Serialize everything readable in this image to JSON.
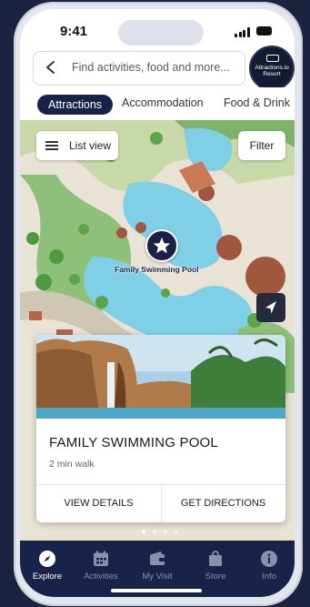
{
  "status_bar": {
    "time": "9:41"
  },
  "search": {
    "placeholder": "Find activities, food and more..."
  },
  "brand": {
    "logo_text": "Attractions.io Resort"
  },
  "tabs": [
    {
      "label": "Attractions",
      "active": true
    },
    {
      "label": "Accommodation",
      "active": false
    },
    {
      "label": "Food & Drink",
      "active": false
    }
  ],
  "map": {
    "list_view_label": "List view",
    "filter_label": "Filter",
    "pin_label": "Family Swimming Pool",
    "pin_icon": "star-icon",
    "location_icon": "navigation-arrow-icon"
  },
  "card": {
    "title": "FAMILY SWIMMING POOL",
    "subtitle": "2 min walk",
    "view_details_label": "VIEW DETAILS",
    "get_directions_label": "GET DIRECTIONS"
  },
  "pagination": {
    "pages": 4,
    "active": 1
  },
  "tab_bar": [
    {
      "label": "Explore",
      "icon": "compass-icon",
      "active": true
    },
    {
      "label": "Activities",
      "icon": "calendar-icon",
      "active": false
    },
    {
      "label": "My Visit",
      "icon": "wallet-icon",
      "active": false
    },
    {
      "label": "Store",
      "icon": "shopping-bag-icon",
      "active": false
    },
    {
      "label": "Info",
      "icon": "info-icon",
      "active": false
    }
  ],
  "colors": {
    "navy": "#192249",
    "pool": "#7fd0e6",
    "grass": "#8fc07a",
    "sand": "#e9e3d6"
  }
}
